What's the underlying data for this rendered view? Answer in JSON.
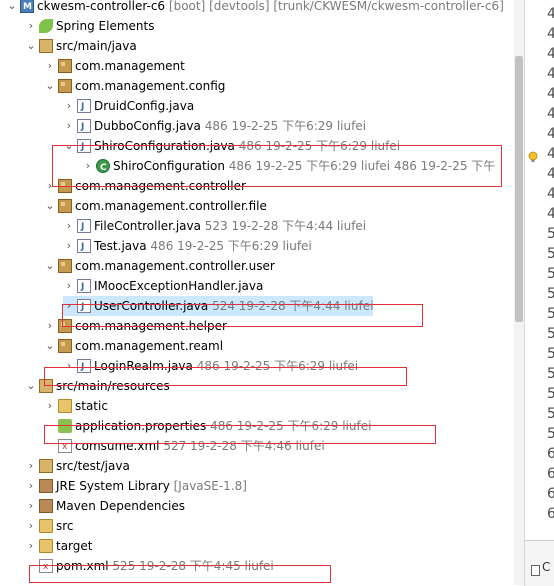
{
  "tree": {
    "rows": [
      {
        "label": "ckwesm-controller-c6",
        "decor": "[boot] [devtools] [trunk/CKWESM/ckwesm-controller-c6]",
        "toggle": "⌄",
        "icon": "proj",
        "depth": 0,
        "name": "project-node"
      },
      {
        "label": "Spring Elements",
        "decor": "",
        "toggle": "›",
        "icon": "leaf",
        "depth": 1,
        "name": "spring-elements-node"
      },
      {
        "label": "src/main/java",
        "decor": "",
        "toggle": "⌄",
        "icon": "srcf",
        "depth": 1,
        "name": "src-main-java-node"
      },
      {
        "label": "com.management",
        "decor": "",
        "toggle": "›",
        "icon": "pkg",
        "depth": 2,
        "name": "package-management-node"
      },
      {
        "label": "com.management.config",
        "decor": "",
        "toggle": "⌄",
        "icon": "pkg",
        "depth": 2,
        "name": "package-config-node"
      },
      {
        "label": "DruidConfig.java",
        "decor": "",
        "toggle": "›",
        "icon": "jfile",
        "depth": 3,
        "name": "druidconfig-file"
      },
      {
        "label": "DubboConfig.java",
        "decor": "486  19-2-25 下午6:29  liufei",
        "toggle": "›",
        "icon": "jfile",
        "depth": 3,
        "name": "dubboconfig-file"
      },
      {
        "label": "ShiroConfiguration.java",
        "decor": "486  19-2-25 下午6:29  liufei",
        "toggle": "⌄",
        "icon": "jfile",
        "depth": 3,
        "name": "shiroconfiguration-file"
      },
      {
        "label": "ShiroConfiguration",
        "decor": "486  19-2-25 下午6:29  liufei  486  19-2-25 下午",
        "toggle": "›",
        "icon": "cls",
        "depth": 4,
        "name": "shiroconfiguration-class"
      },
      {
        "label": "com.management.controller",
        "decor": "",
        "toggle": "›",
        "icon": "pkg",
        "depth": 2,
        "name": "package-controller-node"
      },
      {
        "label": "com.management.controller.file",
        "decor": "",
        "toggle": "⌄",
        "icon": "pkg",
        "depth": 2,
        "name": "package-controller-file-node"
      },
      {
        "label": "FileController.java",
        "decor": "523  19-2-28 下午4:44  liufei",
        "toggle": "›",
        "icon": "jfile",
        "depth": 3,
        "name": "filecontroller-file"
      },
      {
        "label": "Test.java",
        "decor": "486  19-2-25 下午6:29  liufei",
        "toggle": "›",
        "icon": "jfile",
        "depth": 3,
        "name": "test-file"
      },
      {
        "label": "com.management.controller.user",
        "decor": "",
        "toggle": "⌄",
        "icon": "pkg",
        "depth": 2,
        "name": "package-controller-user-node"
      },
      {
        "label": "IMoocExceptionHandler.java",
        "decor": "",
        "toggle": "›",
        "icon": "jfile",
        "depth": 3,
        "name": "imoocexceptionhandler-file"
      },
      {
        "label": "UserController.java",
        "decor": "524  19-2-28 下午4:44  liufei",
        "toggle": "›",
        "icon": "jfile",
        "depth": 3,
        "name": "usercontroller-file",
        "selected": true
      },
      {
        "label": "com.management.helper",
        "decor": "",
        "toggle": "›",
        "icon": "pkg",
        "depth": 2,
        "name": "package-helper-node"
      },
      {
        "label": "com.management.reaml",
        "decor": "",
        "toggle": "⌄",
        "icon": "pkg",
        "depth": 2,
        "name": "package-reaml-node"
      },
      {
        "label": "LoginRealm.java",
        "decor": "486  19-2-25 下午6:29  liufei",
        "toggle": "›",
        "icon": "jfile",
        "depth": 3,
        "name": "loginrealm-file"
      },
      {
        "label": "src/main/resources",
        "decor": "",
        "toggle": "⌄",
        "icon": "srcf",
        "depth": 1,
        "name": "src-main-resources-node"
      },
      {
        "label": "static",
        "decor": "",
        "toggle": "›",
        "icon": "folder",
        "depth": 2,
        "name": "static-folder-node"
      },
      {
        "label": "application.properties",
        "decor": "486  19-2-25 下午6:29  liufei",
        "toggle": "",
        "icon": "props",
        "depth": 2,
        "name": "application-properties-file"
      },
      {
        "label": "comsume.xml",
        "decor": "527  19-2-28 下午4:46  liufei",
        "toggle": "",
        "icon": "xml",
        "depth": 2,
        "name": "comsume-xml-file"
      },
      {
        "label": "src/test/java",
        "decor": "",
        "toggle": "›",
        "icon": "srcf",
        "depth": 1,
        "name": "src-test-java-node"
      },
      {
        "label": "JRE System Library",
        "decor": "[JavaSE-1.8]",
        "toggle": "›",
        "icon": "lib",
        "depth": 1,
        "name": "jre-system-library-node"
      },
      {
        "label": "Maven Dependencies",
        "decor": "",
        "toggle": "›",
        "icon": "lib",
        "depth": 1,
        "name": "maven-dependencies-node"
      },
      {
        "label": "src",
        "decor": "",
        "toggle": "›",
        "icon": "folder",
        "depth": 1,
        "name": "src-folder-node"
      },
      {
        "label": "target",
        "decor": "",
        "toggle": "›",
        "icon": "folder",
        "depth": 1,
        "name": "target-folder-node"
      },
      {
        "label": "pom.xml",
        "decor": "525  19-2-28 下午4:45  liufei",
        "toggle": "",
        "icon": "xml",
        "depth": 1,
        "name": "pom-xml-file"
      }
    ]
  },
  "gutter": {
    "line_digits": [
      "4",
      "4",
      "4",
      "4",
      "4",
      "4",
      "4",
      "4",
      "4",
      "4",
      "4",
      "5",
      "5",
      "5",
      "5",
      "5",
      "5",
      "5",
      "5",
      "5",
      "5",
      "5",
      "6",
      "6",
      "6",
      "6"
    ]
  },
  "bottom_panel": {
    "tab_label": "C"
  },
  "colors": {
    "highlight_box": "#e0303a",
    "selection": "#cce8ff",
    "decoration": "#7a7a7a"
  }
}
